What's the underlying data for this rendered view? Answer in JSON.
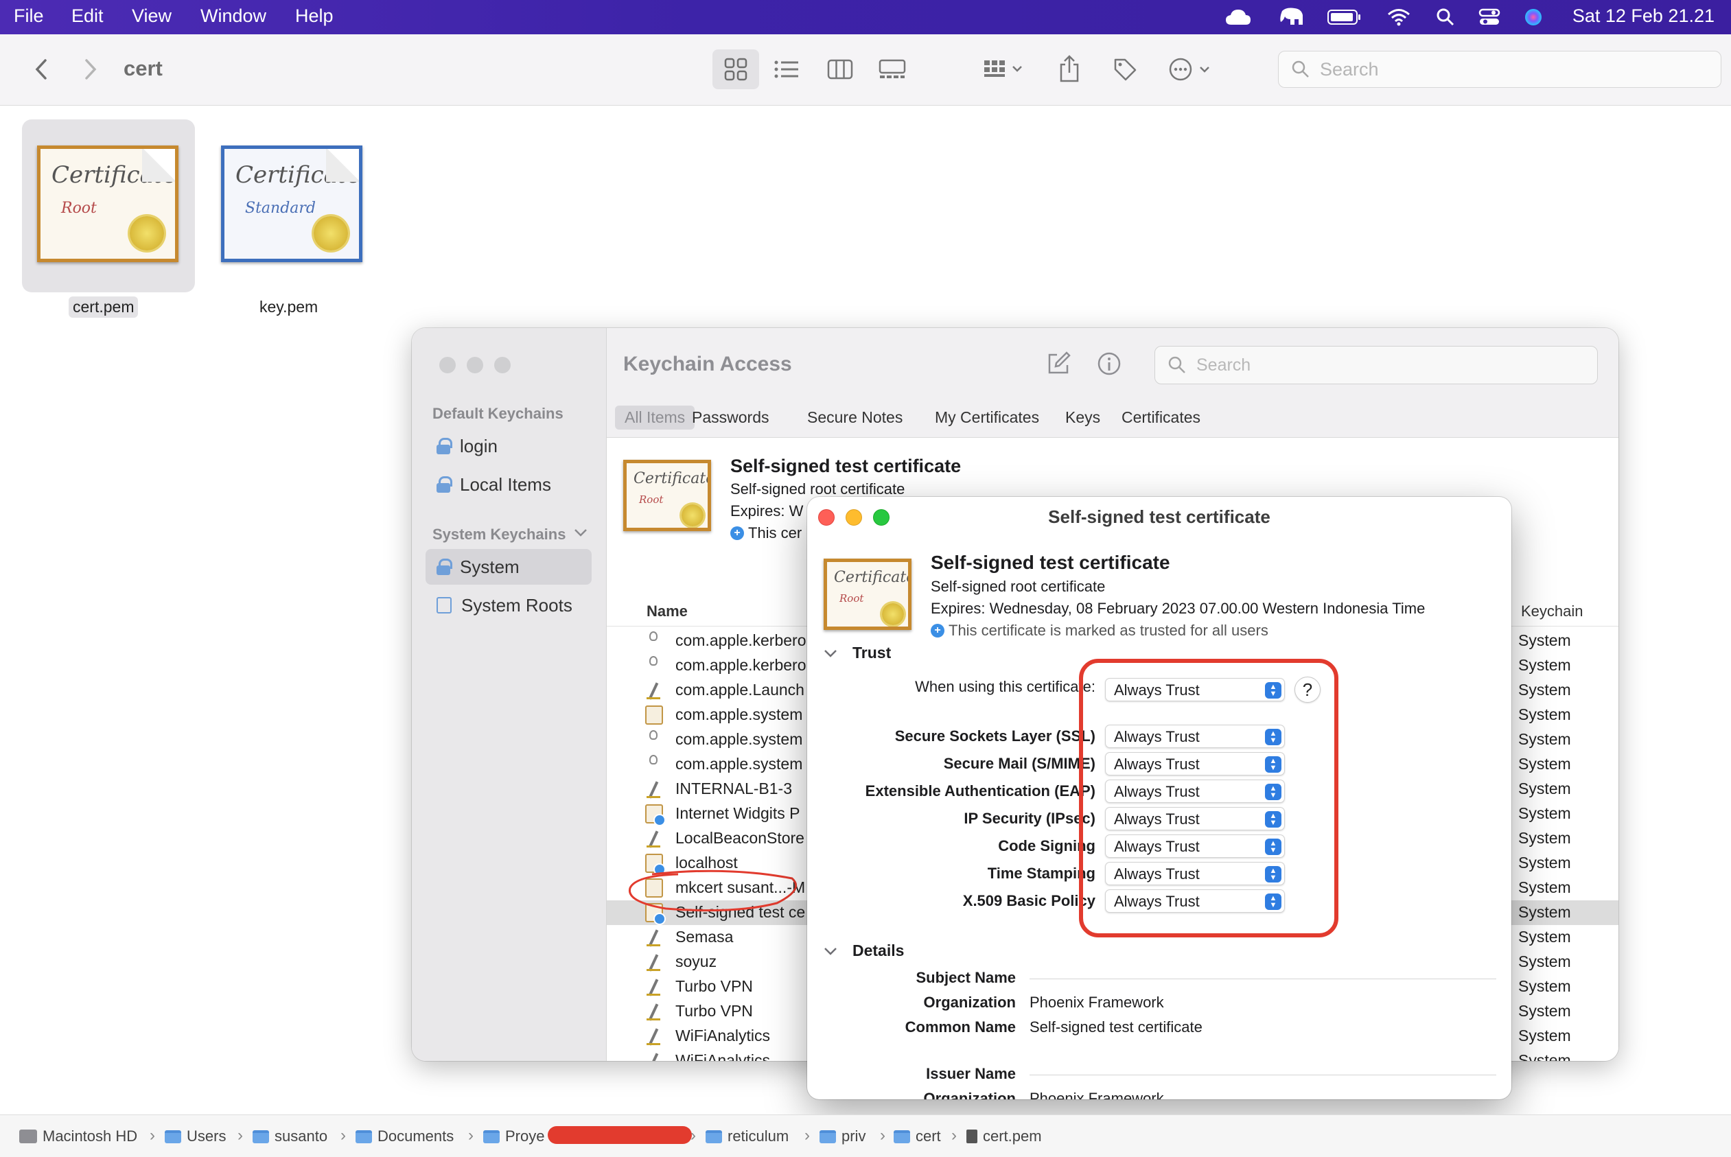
{
  "menubar": {
    "items": [
      "File",
      "Edit",
      "View",
      "Window",
      "Help"
    ],
    "clock": "Sat 12 Feb  21.21"
  },
  "finder": {
    "title": "cert",
    "search_placeholder": "Search",
    "files": [
      {
        "name": "cert.pem",
        "icon": "certificate-root-icon"
      },
      {
        "name": "key.pem",
        "icon": "certificate-standard-icon"
      }
    ],
    "cert_art": {
      "script": "Certificate",
      "root": "Root",
      "standard": "Standard"
    }
  },
  "pathbar": {
    "segments": [
      "Macintosh HD",
      "Users",
      "susanto",
      "Documents",
      "Proye",
      "reticulum",
      "priv",
      "cert",
      "cert.pem"
    ]
  },
  "keychain": {
    "title": "Keychain Access",
    "search_placeholder": "Search",
    "sidebar": {
      "default_header": "Default Keychains",
      "default_items": [
        "login",
        "Local Items"
      ],
      "system_header": "System Keychains",
      "system_items": [
        "System",
        "System Roots"
      ]
    },
    "tabs": [
      "All Items",
      "Passwords",
      "Secure Notes",
      "My Certificates",
      "Keys",
      "Certificates"
    ],
    "summary": {
      "name": "Self-signed test certificate",
      "kind": "Self-signed root certificate",
      "expires": "Expires: W",
      "note": "This cer"
    },
    "columns": {
      "name": "Name",
      "keychain": "Keychain"
    },
    "rows": [
      {
        "name": "com.apple.kerbero",
        "icon": "key",
        "keychain": "System"
      },
      {
        "name": "com.apple.kerbero",
        "icon": "key",
        "keychain": "System"
      },
      {
        "name": "com.apple.Launch",
        "icon": "pen",
        "keychain": "System"
      },
      {
        "name": "com.apple.system",
        "icon": "cert",
        "keychain": "System"
      },
      {
        "name": "com.apple.system",
        "icon": "key",
        "keychain": "System"
      },
      {
        "name": "com.apple.system",
        "icon": "key",
        "keychain": "System"
      },
      {
        "name": "INTERNAL-B1-3",
        "icon": "pen",
        "keychain": "System"
      },
      {
        "name": "Internet Widgits P",
        "icon": "certblue",
        "keychain": "System"
      },
      {
        "name": "LocalBeaconStore",
        "icon": "pen",
        "keychain": "System"
      },
      {
        "name": "localhost",
        "icon": "certblue",
        "keychain": "System"
      },
      {
        "name": "mkcert susant...-M",
        "icon": "cert",
        "keychain": "System"
      },
      {
        "name": "Self-signed test ce",
        "icon": "certblue",
        "keychain": "System",
        "selected": true
      },
      {
        "name": "Semasa",
        "icon": "pen",
        "keychain": "System"
      },
      {
        "name": "soyuz",
        "icon": "pen",
        "keychain": "System"
      },
      {
        "name": "Turbo VPN",
        "icon": "pen",
        "keychain": "System"
      },
      {
        "name": "Turbo VPN",
        "icon": "pen",
        "keychain": "System"
      },
      {
        "name": "WiFiAnalytics",
        "icon": "pen",
        "keychain": "System"
      },
      {
        "name": "WiFiAnalytics",
        "icon": "pen",
        "keychain": "System"
      }
    ]
  },
  "dialog": {
    "title": "Self-signed test certificate",
    "name": "Self-signed test certificate",
    "kind": "Self-signed root certificate",
    "expires": "Expires: Wednesday, 08 February 2023 07.00.00 Western Indonesia Time",
    "trusted_note": "This certificate is marked as trusted for all users",
    "trust_section": "Trust",
    "when_using_label": "When using this certificate:",
    "when_using_value": "Always Trust",
    "help": "?",
    "policies": [
      {
        "label": "Secure Sockets Layer (SSL)",
        "value": "Always Trust"
      },
      {
        "label": "Secure Mail (S/MIME)",
        "value": "Always Trust"
      },
      {
        "label": "Extensible Authentication (EAP)",
        "value": "Always Trust"
      },
      {
        "label": "IP Security (IPsec)",
        "value": "Always Trust"
      },
      {
        "label": "Code Signing",
        "value": "Always Trust"
      },
      {
        "label": "Time Stamping",
        "value": "Always Trust"
      },
      {
        "label": "X.509 Basic Policy",
        "value": "Always Trust"
      }
    ],
    "details_section": "Details",
    "details": {
      "subject_header": "Subject Name",
      "subject": [
        {
          "label": "Organization",
          "value": "Phoenix Framework"
        },
        {
          "label": "Common Name",
          "value": "Self-signed test certificate"
        }
      ],
      "issuer_header": "Issuer Name",
      "issuer_partial": {
        "label": "Organization",
        "value": "Phoenix Framework"
      }
    }
  },
  "colors": {
    "menubar": "#3d23a8",
    "annotation_red": "#e23b2e",
    "accent_blue": "#2f7de1"
  }
}
